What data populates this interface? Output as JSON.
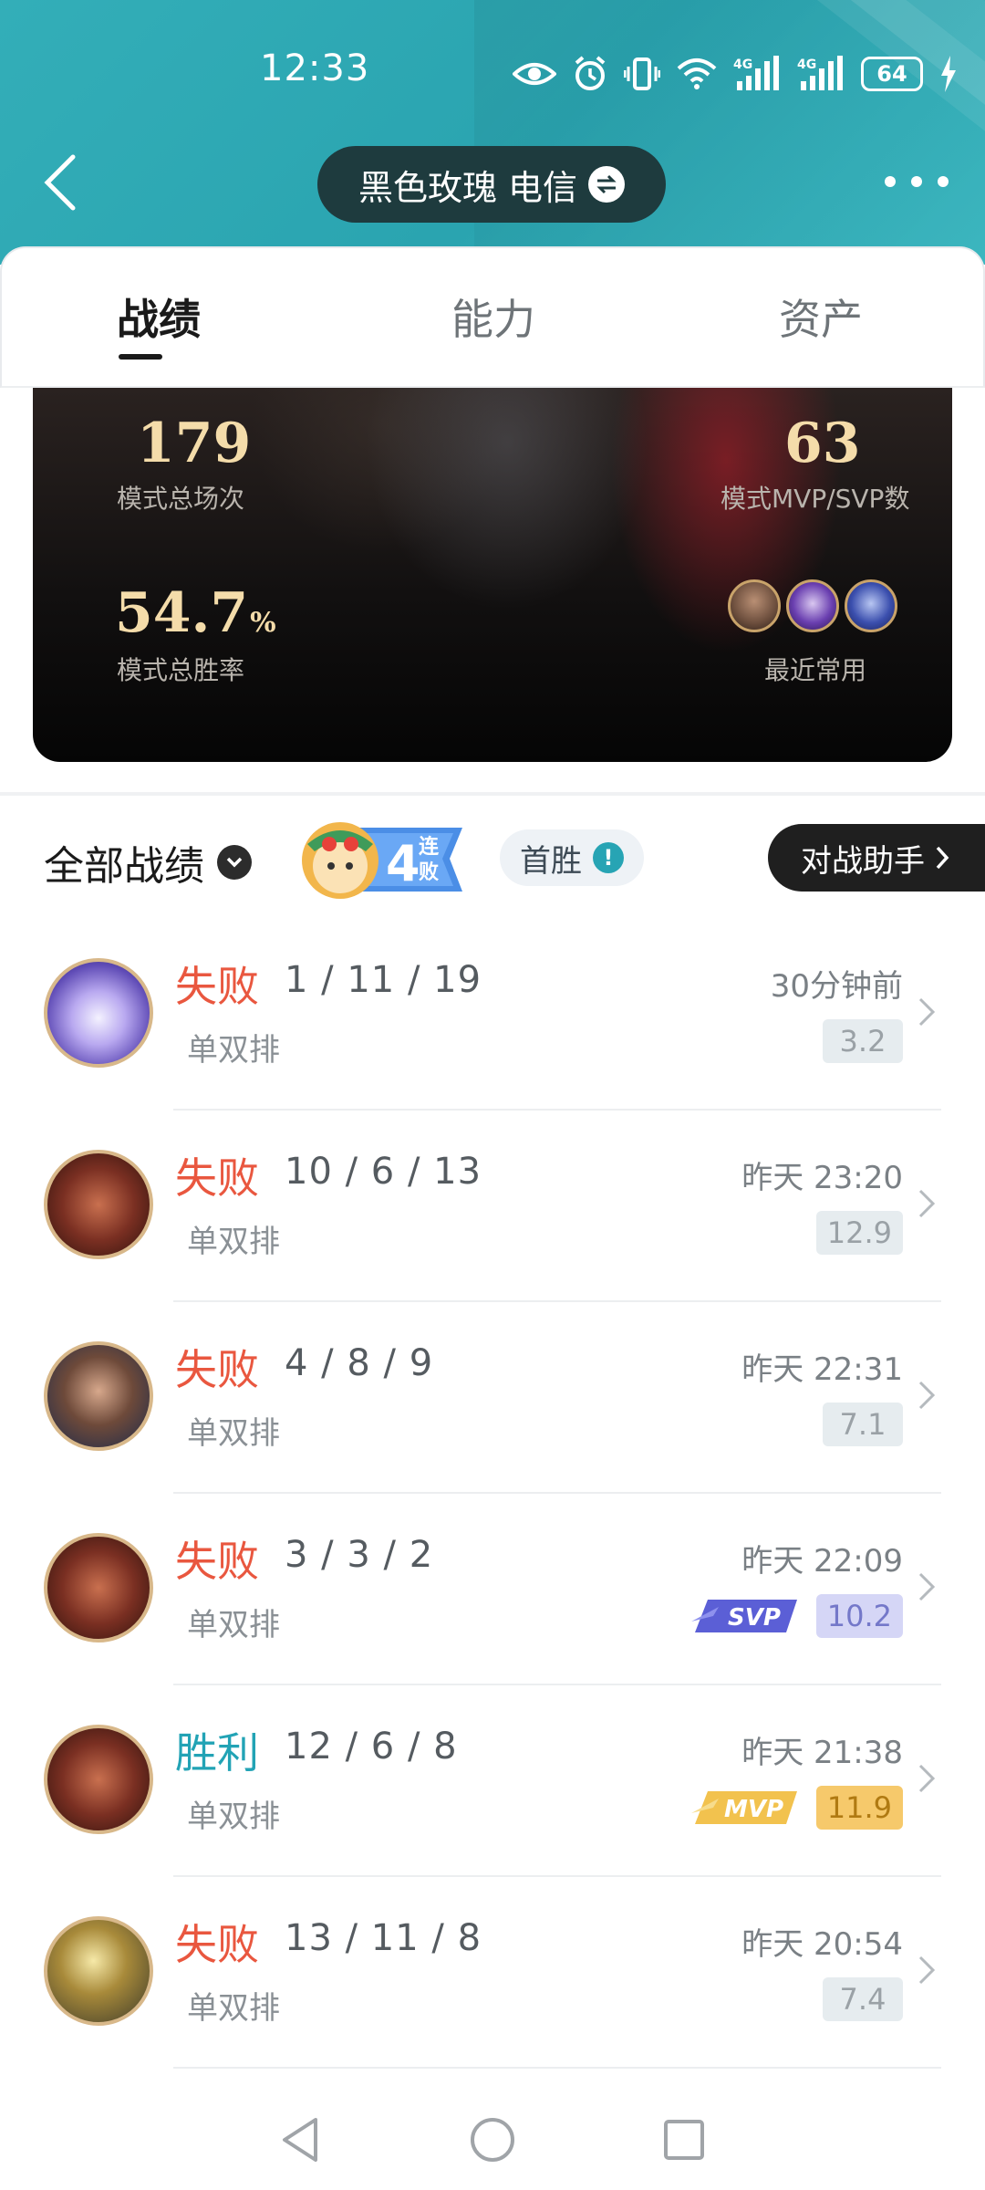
{
  "status_bar": {
    "time": "12:33",
    "battery": "64"
  },
  "header": {
    "title": "黑色玫瑰 电信"
  },
  "tabs": [
    {
      "label": "战绩",
      "active": true
    },
    {
      "label": "能力",
      "active": false
    },
    {
      "label": "资产",
      "active": false
    }
  ],
  "stats": {
    "total_matches": "179",
    "total_matches_label": "模式总场次",
    "mvp_count": "63",
    "mvp_count_label": "模式MVP/SVP数",
    "win_rate": "54.7",
    "win_rate_unit": "%",
    "win_rate_label": "模式总胜率",
    "recent_label": "最近常用"
  },
  "filter": {
    "label": "全部战绩",
    "streak_number": "4",
    "streak_text_1": "连",
    "streak_text_2": "败",
    "first_win": "首胜",
    "first_win_info": "!",
    "assistant": "对战助手"
  },
  "matches": [
    {
      "result": "失败",
      "type": "lose",
      "kda": "1 / 11 / 19",
      "mode": "单双排",
      "time": "30分钟前",
      "score": "3.2",
      "badge": "",
      "score_style": "normal"
    },
    {
      "result": "失败",
      "type": "lose",
      "kda": "10 / 6 / 13",
      "mode": "单双排",
      "time": "昨天 23:20",
      "score": "12.9",
      "badge": "",
      "score_style": "normal"
    },
    {
      "result": "失败",
      "type": "lose",
      "kda": "4 / 8 / 9",
      "mode": "单双排",
      "time": "昨天 22:31",
      "score": "7.1",
      "badge": "",
      "score_style": "normal"
    },
    {
      "result": "失败",
      "type": "lose",
      "kda": "3 / 3 / 2",
      "mode": "单双排",
      "time": "昨天 22:09",
      "score": "10.2",
      "badge": "SVP",
      "score_style": "svp"
    },
    {
      "result": "胜利",
      "type": "win",
      "kda": "12 / 6 / 8",
      "mode": "单双排",
      "time": "昨天 21:38",
      "score": "11.9",
      "badge": "MVP",
      "score_style": "mvp"
    },
    {
      "result": "失败",
      "type": "lose",
      "kda": "13 / 11 / 8",
      "mode": "单双排",
      "time": "昨天 20:54",
      "score": "7.4",
      "badge": "",
      "score_style": "normal"
    }
  ],
  "colors": {
    "header_teal": "#2ea8b3",
    "lose": "#e9573f",
    "win": "#22a3b5",
    "gold_text": "#f4dcaa"
  }
}
